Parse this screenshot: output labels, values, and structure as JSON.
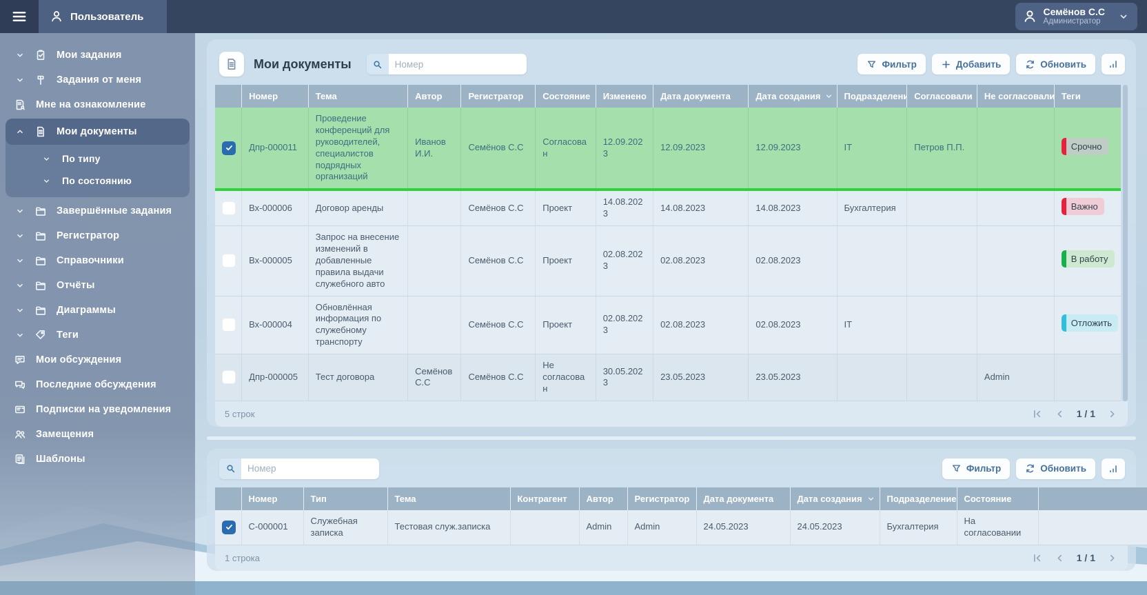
{
  "topbar": {
    "menu_label": "Пользователь",
    "user_name": "Семёнов С.С",
    "user_role": "Администратор"
  },
  "sidebar": {
    "items": [
      {
        "label": "Мои задания",
        "icon": "clipboard-icon",
        "chevron": "down"
      },
      {
        "label": "Задания от меня",
        "icon": "sign-icon",
        "chevron": "down"
      },
      {
        "label": "Мне на ознакомление",
        "icon": "doc-review-icon"
      },
      {
        "label": "Мои документы",
        "icon": "document-icon",
        "chevron": "up",
        "active": true,
        "children": [
          {
            "label": "По типу",
            "chevron": "down"
          },
          {
            "label": "По состоянию",
            "chevron": "down"
          }
        ]
      },
      {
        "label": "Завершённые задания",
        "icon": "folder-icon",
        "chevron": "down"
      },
      {
        "label": "Регистратор",
        "icon": "folder-icon",
        "chevron": "down"
      },
      {
        "label": "Справочники",
        "icon": "folder-icon",
        "chevron": "down"
      },
      {
        "label": "Отчёты",
        "icon": "folder-icon",
        "chevron": "down"
      },
      {
        "label": "Диаграммы",
        "icon": "folder-icon",
        "chevron": "down"
      },
      {
        "label": "Теги",
        "icon": "tag-icon",
        "chevron": "down"
      },
      {
        "label": "Мои обсуждения",
        "icon": "chat-icon"
      },
      {
        "label": "Последние обсуждения",
        "icon": "chats-icon"
      },
      {
        "label": "Подписки на уведомления",
        "icon": "card-icon"
      },
      {
        "label": "Замещения",
        "icon": "people-icon"
      },
      {
        "label": "Шаблоны",
        "icon": "templates-icon"
      }
    ]
  },
  "documents_panel": {
    "title": "Мои документы",
    "search_placeholder": "Номер",
    "filter_label": "Фильтр",
    "add_label": "Добавить",
    "refresh_label": "Обновить",
    "columns": [
      "Номер",
      "Тема",
      "Автор",
      "Регистратор",
      "Состояние",
      "Изменено",
      "Дата документа",
      "Дата создания",
      "Подразделение",
      "Согласовали",
      "Не согласовали",
      "Теги"
    ],
    "sort_column": "Дата создания",
    "rows": [
      {
        "checked": true,
        "highlight": "green",
        "num": "Дпр-000011",
        "theme": "Проведение конференций для руководителей, специалистов подрядных организаций",
        "author": "Иванов И.И.",
        "registrar": "Семёнов С.С",
        "state": "Согласован",
        "modified": "12.09.2023",
        "doc_date": "12.09.2023",
        "created": "12.09.2023",
        "department": "IT",
        "approved": "Петров П.П.",
        "not_approved": "",
        "tag": {
          "label": "Срочно",
          "bar": "#e5233d",
          "bg": "#bfcdc4"
        }
      },
      {
        "checked": false,
        "num": "Вх-000006",
        "theme": "Договор аренды",
        "author": "",
        "registrar": "Семёнов С.С",
        "state": "Проект",
        "modified": "14.08.2023",
        "doc_date": "14.08.2023",
        "created": "14.08.2023",
        "department": "Бухгалтерия",
        "approved": "",
        "not_approved": "",
        "tag": {
          "label": "Важно",
          "bar": "#e5233d",
          "bg": "#f0cdd6"
        }
      },
      {
        "checked": false,
        "num": "Вх-000005",
        "theme": "Запрос на внесение изменений в добавленные правила выдачи служебного авто",
        "author": "",
        "registrar": "Семёнов С.С",
        "state": "Проект",
        "modified": "02.08.2023",
        "doc_date": "02.08.2023",
        "created": "02.08.2023",
        "department": "",
        "approved": "",
        "not_approved": "",
        "tag": {
          "label": "В работу",
          "bar": "#17b04d",
          "bg": "#cde9d2"
        }
      },
      {
        "checked": false,
        "num": "Вх-000004",
        "theme": "Обновлённая информация по служебному транспорту",
        "author": "",
        "registrar": "Семёнов С.С",
        "state": "Проект",
        "modified": "02.08.2023",
        "doc_date": "02.08.2023",
        "created": "02.08.2023",
        "department": "IT",
        "approved": "",
        "not_approved": "",
        "tag": {
          "label": "Отложить",
          "bar": "#31bede",
          "bg": "#c9ecf4"
        }
      },
      {
        "checked": false,
        "shade": true,
        "num": "Дпр-000005",
        "theme": "Тест договора",
        "author": "Семёнов С.С",
        "registrar": "Семёнов С.С",
        "state": "Не согласован",
        "modified": "30.05.2023",
        "doc_date": "23.05.2023",
        "created": "23.05.2023",
        "department": "",
        "approved": "",
        "not_approved": "Admin",
        "tag": null
      }
    ],
    "row_count_label": "5 строк",
    "page_label": "1 / 1"
  },
  "registry_panel": {
    "search_placeholder": "Номер",
    "filter_label": "Фильтр",
    "refresh_label": "Обновить",
    "columns": [
      "Номер",
      "Тип",
      "Тема",
      "Контрагент",
      "Автор",
      "Регистратор",
      "Дата документа",
      "Дата создания",
      "Подразделение",
      "Состояние",
      ""
    ],
    "sort_column": "Дата создания",
    "rows": [
      {
        "checked": true,
        "num": "С-000001",
        "type": "Служебная записка",
        "theme": "Тестовая служ.записка",
        "counterparty": "",
        "author": "Admin",
        "registrar": "Admin",
        "doc_date": "24.05.2023",
        "created": "24.05.2023",
        "department": "Бухгалтерия",
        "state": "На согласовании",
        "extra": ""
      }
    ],
    "row_count_label": "1 строка",
    "page_label": "1 / 1"
  },
  "colors": {
    "selected_row_bg": "#a5dfab",
    "selected_row_border": "#2fd23c",
    "table_header_bg": "#9cb2c5",
    "checkbox_checked": "#2a6cb0",
    "topbar_bg": "#35455f",
    "sidebar_bg": "#8092ab"
  }
}
